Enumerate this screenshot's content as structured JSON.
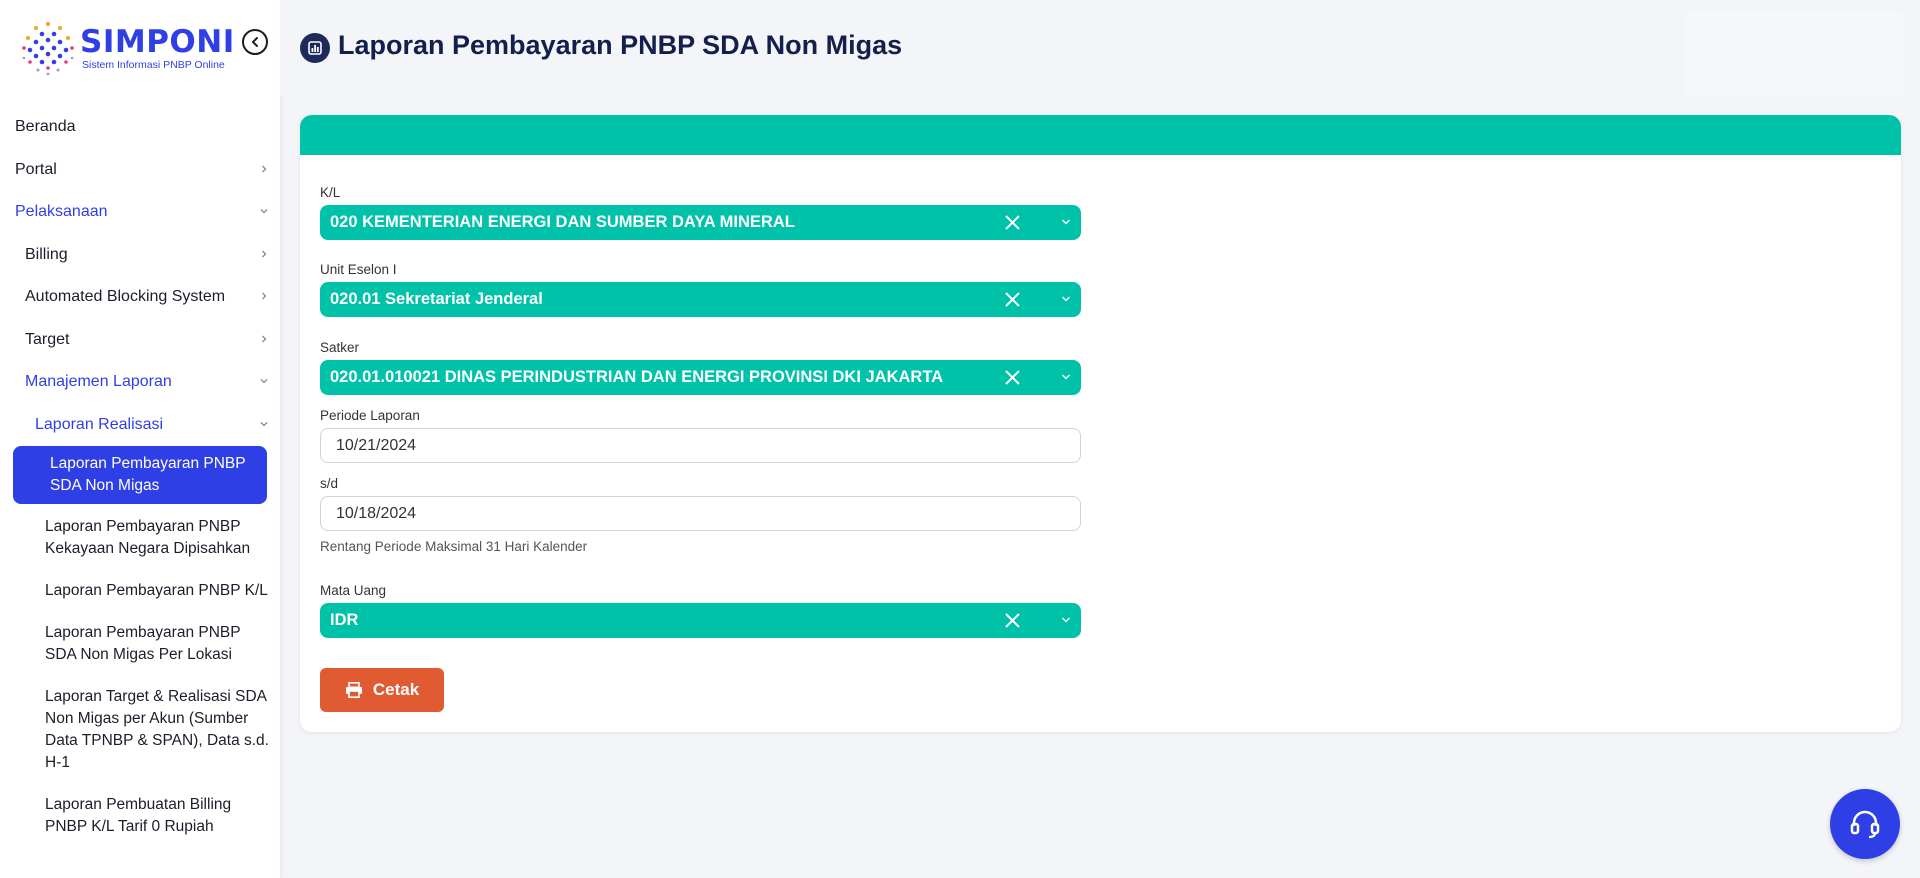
{
  "app": {
    "logo_title": "SIMPONI",
    "logo_subtitle": "Sistem Informasi PNBP Online",
    "brand_color": "#2f3fe6",
    "accent_color": "#00c2a8"
  },
  "sidebar": {
    "items": [
      {
        "label": "Beranda"
      },
      {
        "label": "Portal"
      },
      {
        "label": "Pelaksanaan"
      },
      {
        "label": "Billing"
      },
      {
        "label": "Automated Blocking System"
      },
      {
        "label": "Target"
      },
      {
        "label": "Manajemen Laporan"
      },
      {
        "label": "Laporan Realisasi"
      }
    ],
    "current": "Laporan Pembayaran PNBP SDA Non Migas",
    "sub_items": [
      {
        "label": "Laporan Pembayaran PNBP Kekayaan Negara Dipisahkan"
      },
      {
        "label": "Laporan Pembayaran PNBP K/L"
      },
      {
        "label": "Laporan Pembayaran PNBP SDA Non Migas Per Lokasi"
      },
      {
        "label": "Laporan Target & Realisasi SDA Non Migas per Akun (Sumber Data TPNBP & SPAN), Data s.d. H-1"
      },
      {
        "label": "Laporan Pembuatan Billing PNBP K/L Tarif 0 Rupiah"
      }
    ]
  },
  "header": {
    "title": "Laporan Pembayaran PNBP SDA Non Migas",
    "icon": "chart-icon"
  },
  "form": {
    "kl": {
      "label": "K/L",
      "value": "020 KEMENTERIAN ENERGI DAN SUMBER DAYA MINERAL"
    },
    "eselon": {
      "label": "Unit Eselon I",
      "value": "020.01 Sekretariat Jenderal"
    },
    "satker": {
      "label": "Satker",
      "value": "020.01.010021 DINAS PERINDUSTRIAN DAN ENERGI PROVINSI DKI JAKARTA"
    },
    "periode": {
      "label": "Periode Laporan",
      "value": "10/21/2024"
    },
    "sd": {
      "label": "s/d",
      "value": "10/18/2024"
    },
    "hint": "Rentang Periode Maksimal 31 Hari Kalender",
    "currency": {
      "label": "Mata Uang",
      "value": "IDR"
    },
    "print_label": "Cetak"
  }
}
